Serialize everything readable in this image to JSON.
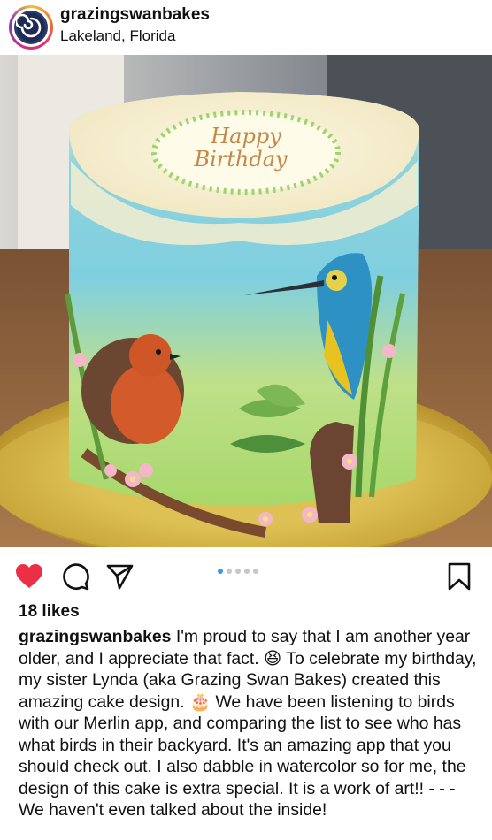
{
  "post": {
    "username": "grazingswanbakes",
    "location": "Lakeland, Florida",
    "cake_text": [
      "Happy",
      "Birthday"
    ],
    "likes": "18 likes",
    "caption_username": "grazingswanbakes",
    "caption_text": "I'm proud to say that I am another year older, and I appreciate that fact. 😆 To celebrate my birthday, my sister Lynda (aka Grazing Swan Bakes) created this amazing cake design. 🎂 We have been listening to birds with our Merlin app, and comparing the list to see who has what birds in their backyard. It's an amazing app that you should check out. I also dabble in watercolor so for me, the design of this cake is extra special. It is a work of art!! - - - We haven't even talked about the inside!",
    "carousel": {
      "count": 5,
      "active_index": 1
    }
  },
  "icons": {
    "like": "heart-icon",
    "comment": "comment-icon",
    "share": "share-icon",
    "save": "bookmark-icon"
  },
  "colors": {
    "like_red": "#ed2f45",
    "carousel_active": "#3897f0"
  }
}
